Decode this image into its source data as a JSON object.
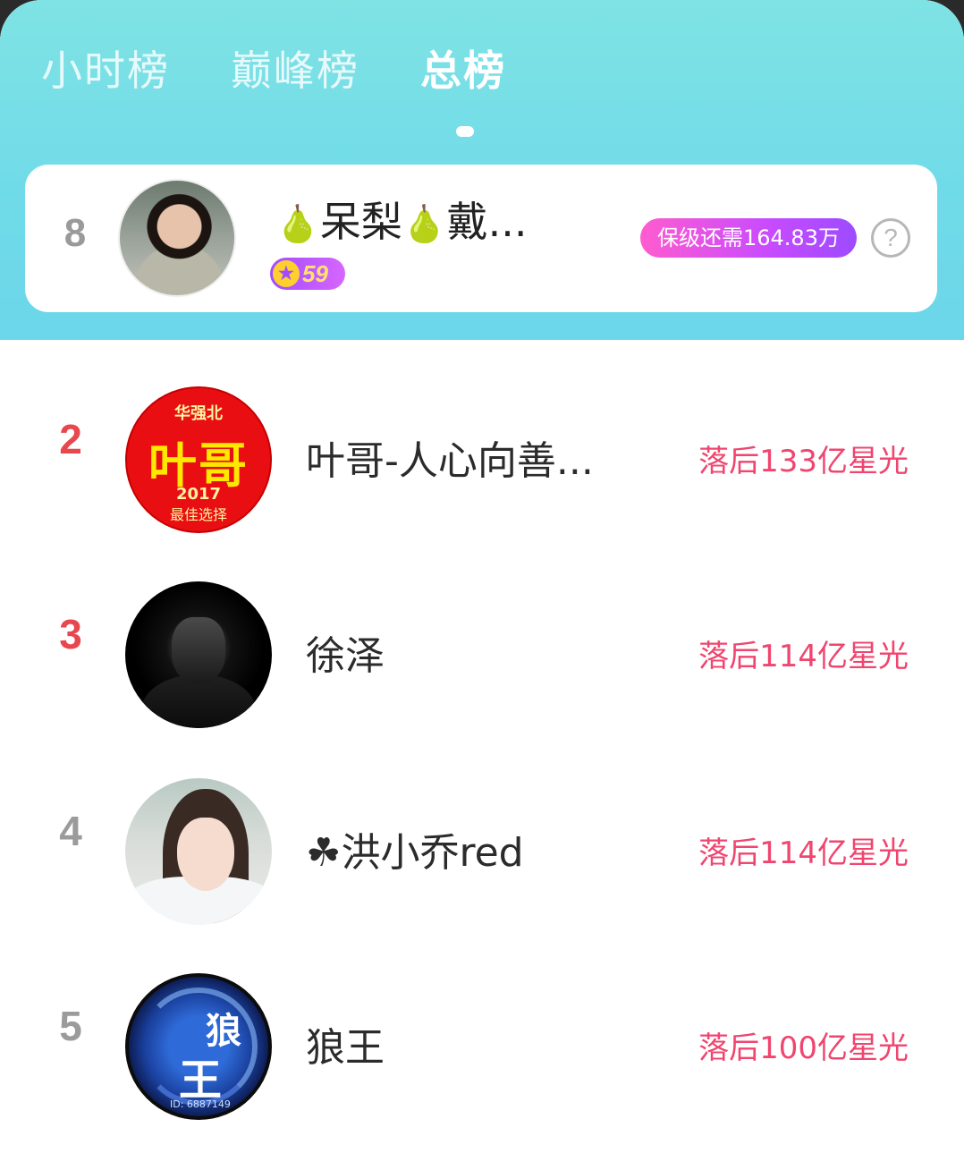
{
  "tabs": [
    {
      "label": "小时榜",
      "active": false
    },
    {
      "label": "巅峰榜",
      "active": false
    },
    {
      "label": "总榜",
      "active": true
    }
  ],
  "me": {
    "rank": "8",
    "name": "呆梨",
    "name_suffix": "戴...",
    "name_icon": "pear-emoji",
    "level": "59",
    "keep_text": "保级还需164.83万",
    "help_icon": "question-mark-icon"
  },
  "avatar_ye": {
    "line1": "华强北",
    "line2": "叶哥",
    "line3": "2017",
    "line4": "最佳选择"
  },
  "avatar_lang": {
    "char1": "狼",
    "char2": "王",
    "id": "ID: 6887149"
  },
  "ranking": [
    {
      "rank": "2",
      "rank_color": "#e8474e",
      "name": "叶哥-人心向善...",
      "behind": "落后133亿星光"
    },
    {
      "rank": "3",
      "rank_color": "#e8474e",
      "name": "徐泽",
      "behind": "落后114亿星光"
    },
    {
      "rank": "4",
      "rank_color": "#9b9b9b",
      "name": "☘洪小乔red",
      "behind": "落后114亿星光"
    },
    {
      "rank": "5",
      "rank_color": "#9b9b9b",
      "name": "狼王",
      "behind": "落后100亿星光"
    }
  ],
  "colors": {
    "header_top": "#7fe3e4",
    "header_bottom": "#6cd6ea",
    "behind_text": "#f0456f",
    "keep_pill": "#c74bff"
  }
}
